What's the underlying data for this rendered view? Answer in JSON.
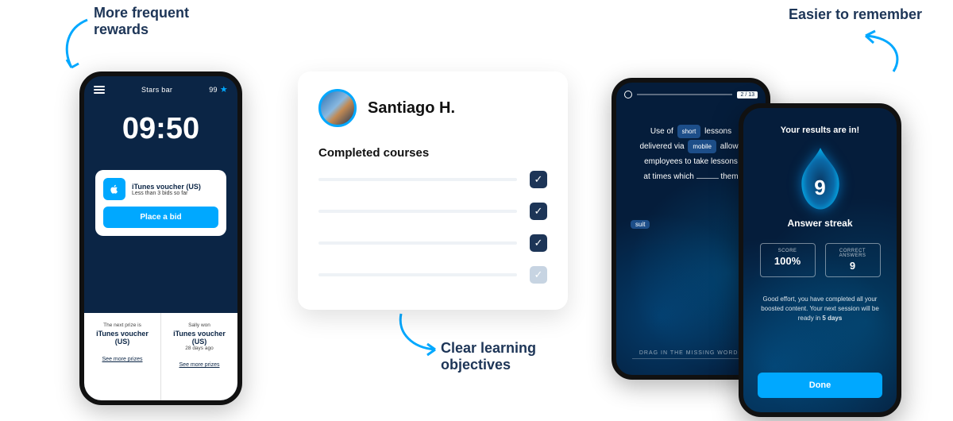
{
  "annotations": {
    "rewards": "More frequent rewards",
    "objectives": "Clear learning objectives",
    "easier": "Easier to remember"
  },
  "phone1": {
    "topbar_label": "Stars bar",
    "stars": "99",
    "time": "09:50",
    "voucher_title": "iTunes voucher (US)",
    "voucher_sub": "Less than 3 bids so far",
    "cta": "Place a bid",
    "footer": {
      "left_sub": "The next prize is",
      "left_main": "iTunes voucher (US)",
      "left_link": "See more prizes",
      "right_sub": "Sally won",
      "right_main": "iTunes voucher (US)",
      "right_sub2": "28 days ago",
      "right_link": "See more prizes"
    }
  },
  "courses": {
    "name": "Santiago H.",
    "section": "Completed courses",
    "rows": [
      {
        "done": true
      },
      {
        "done": true
      },
      {
        "done": true
      },
      {
        "done": false
      }
    ]
  },
  "phone2": {
    "page": "2 / 13",
    "text_parts": {
      "p1a": "Use of",
      "chip1": "short",
      "p1b": "lessons",
      "p2a": "delivered via",
      "chip2": "mobile",
      "p2b": "allows",
      "p3": "employees to take lessons",
      "p4a": "at times which",
      "p4b": "them"
    },
    "pool_chip": "suit",
    "drag_note": "DRAG IN THE MISSING WORDS"
  },
  "phone3": {
    "title": "Your results are in!",
    "streak_number": "9",
    "streak_label": "Answer streak",
    "stats": {
      "score_label": "SCORE",
      "score_value": "100%",
      "correct_label": "CORRECT ANSWERS",
      "correct_value": "9"
    },
    "note_a": "Good effort, you have completed all your boosted content. Your next session will be ready in ",
    "note_b": "5 days",
    "done": "Done"
  }
}
